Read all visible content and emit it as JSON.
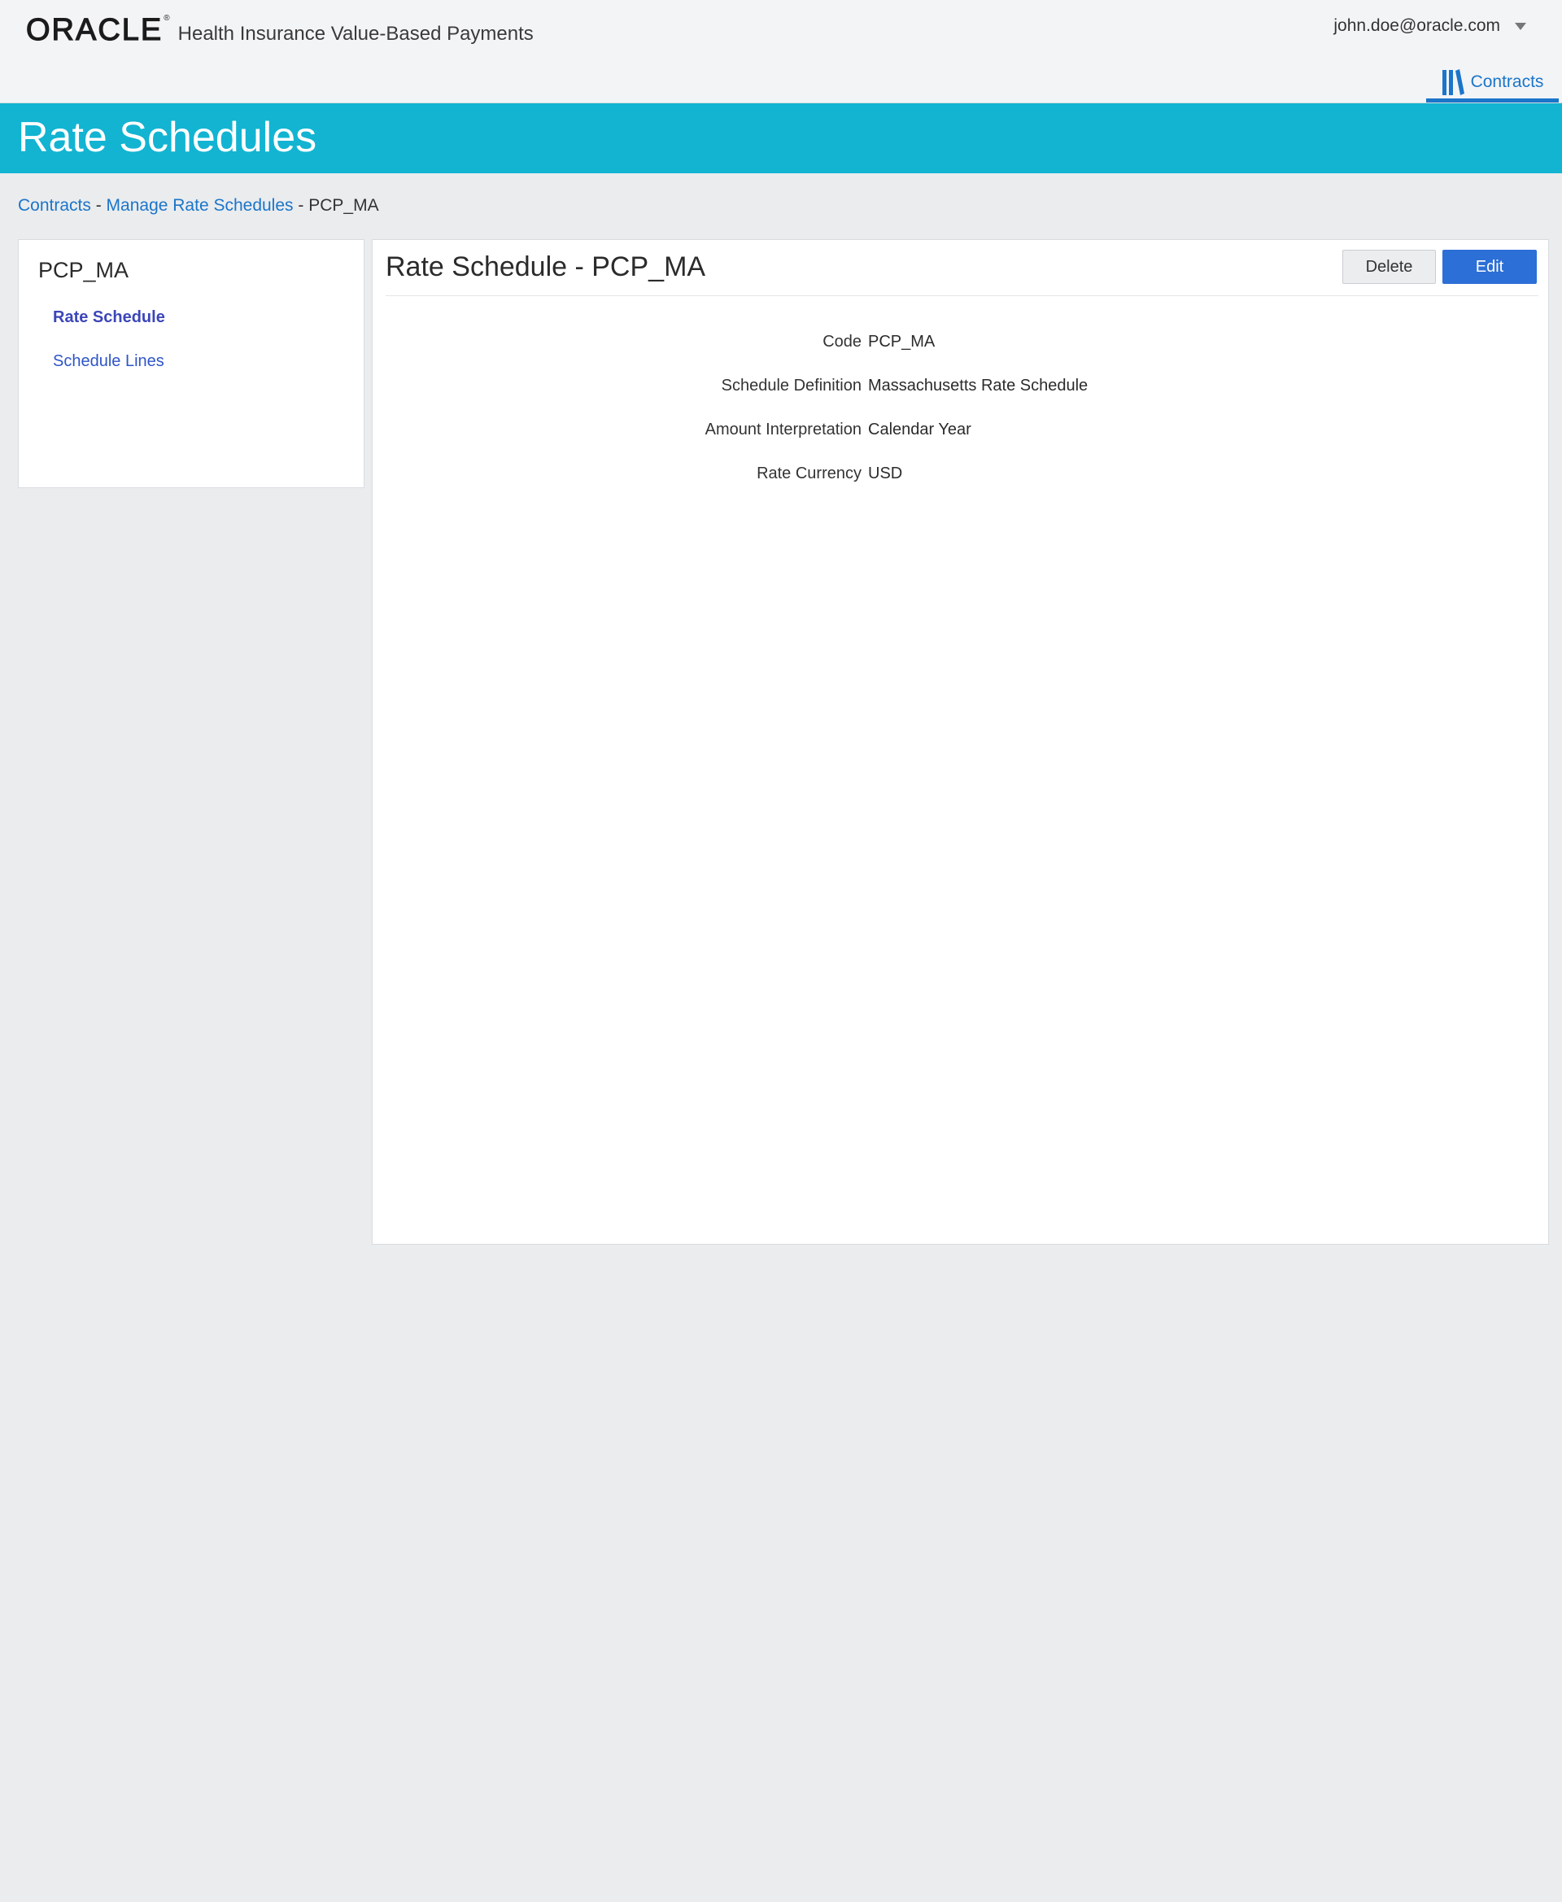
{
  "header": {
    "logo_text": "ORACLE",
    "logo_mark": "®",
    "app_name": "Health Insurance Value-Based Payments",
    "user_email": "john.doe@oracle.com",
    "user_menu_icon": "chevron-down-icon",
    "nav_tab": {
      "label": "Contracts",
      "icon": "books-icon"
    }
  },
  "page_title": "Rate Schedules",
  "breadcrumb": {
    "items": [
      "Contracts",
      "Manage Rate Schedules",
      "PCP_MA"
    ],
    "separator": "-"
  },
  "sidebar": {
    "title": "PCP_MA",
    "items": [
      {
        "label": "Rate Schedule",
        "active": true
      },
      {
        "label": "Schedule Lines",
        "active": false
      }
    ]
  },
  "main": {
    "title": "Rate Schedule - PCP_MA",
    "buttons": {
      "delete_label": "Delete",
      "edit_label": "Edit"
    },
    "fields": [
      {
        "label": "Code",
        "value": "PCP_MA"
      },
      {
        "label": "Schedule Definition",
        "value": "Massachusetts Rate Schedule"
      },
      {
        "label": "Amount Interpretation",
        "value": "Calendar Year"
      },
      {
        "label": "Rate Currency",
        "value": "USD"
      }
    ]
  },
  "colors": {
    "accent": "#12b4d2",
    "link": "#1b75c9",
    "primary_button": "#2c6fd6"
  }
}
